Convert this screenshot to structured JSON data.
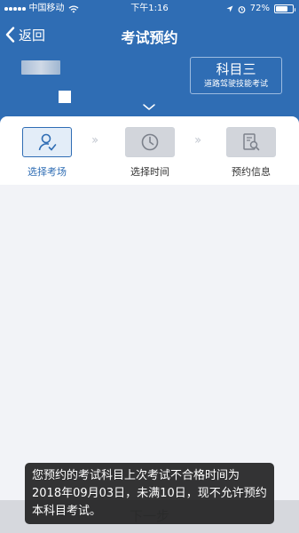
{
  "status_bar": {
    "carrier": "中国移动",
    "time": "下午1:16",
    "battery_text": "72%",
    "battery_level": 0.72
  },
  "nav": {
    "back_label": "返回",
    "title": "考试预约"
  },
  "subject": {
    "name": "科目三",
    "description": "道路驾驶技能考试"
  },
  "steps": [
    {
      "label": "选择考场",
      "icon": "person-check-icon",
      "active": true
    },
    {
      "label": "选择时间",
      "icon": "clock-icon",
      "active": false
    },
    {
      "label": "预约信息",
      "icon": "document-search-icon",
      "active": false
    }
  ],
  "bottom": {
    "next_label": "下一步"
  },
  "toast": {
    "message": "您预约的考试科目上次考试不合格时间为2018年09月03日，未满10日，现不允许预约本科目考试。"
  },
  "colors": {
    "primary": "#2f6db4",
    "background": "#f2f3f7",
    "toast_bg": "#1e1e1e"
  }
}
